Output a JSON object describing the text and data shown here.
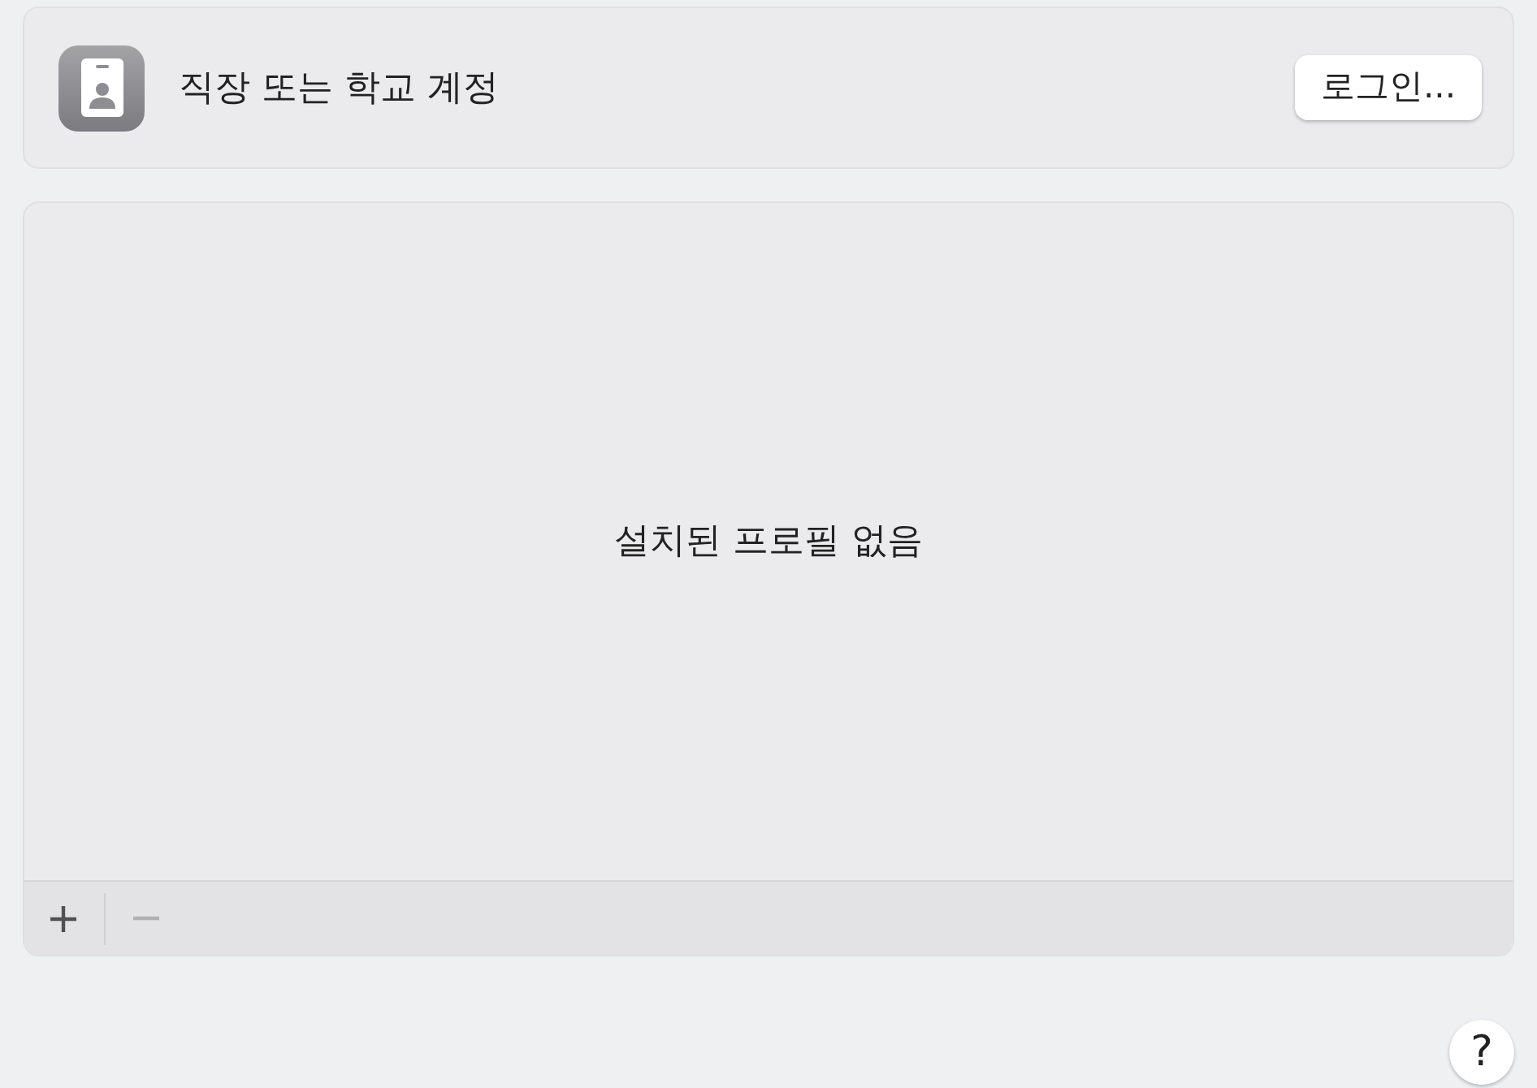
{
  "account": {
    "title": "직장 또는 학교 계정",
    "button": "로그인..."
  },
  "profiles": {
    "empty_message": "설치된 프로필 없음",
    "add_disabled": false,
    "remove_disabled": true
  },
  "help": {
    "label": "?"
  }
}
